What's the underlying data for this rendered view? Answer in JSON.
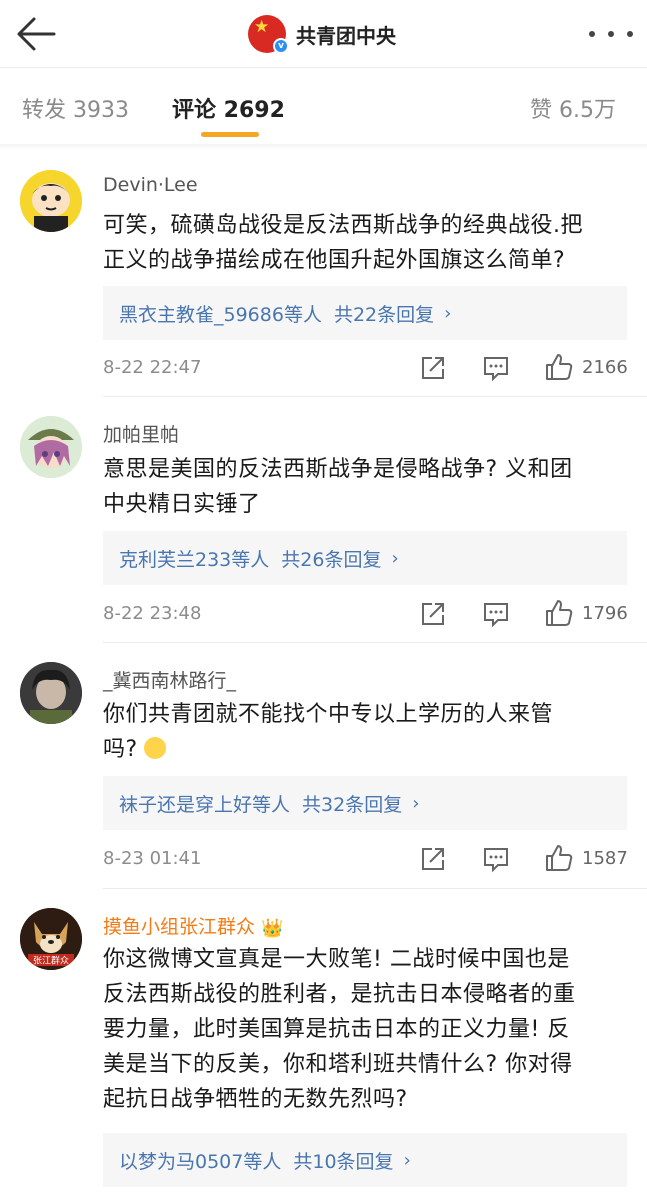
{
  "header": {
    "account_name": "共青团中央",
    "back_icon": "back-arrow-icon",
    "more_icon": "more-dots-icon"
  },
  "tabs": {
    "repost_label": "转发 3933",
    "comment_label": "评论 2692",
    "like_label": "赞 6.5万",
    "accent": "#f6a623"
  },
  "comments": [
    {
      "user": "Devin·Lee",
      "text_line1": "可笑，硫磺岛战役是反法西斯战争的经典战役.把",
      "text_line2": "正义的战争描绘成在他国升起外国旗这么简单?",
      "reply_user": "黑衣主教雀_59686",
      "reply_etc": "等人",
      "reply_count": "共22条回复",
      "time": "8-22 22:47",
      "likes": "2166"
    },
    {
      "user": "加帕里帕",
      "text_line1": "意思是美国的反法西斯战争是侵略战争? 义和团",
      "text_line2": "中央精日实锤了",
      "reply_user": "克利芙兰233",
      "reply_etc": "等人",
      "reply_count": "共26条回复",
      "time": "8-22 23:48",
      "likes": "1796"
    },
    {
      "user": "_冀西南林路行_",
      "text_line1": "你们共青团就不能找个中专以上学历的人来管",
      "text_line2": "吗?",
      "reply_user": "袜子还是穿上好",
      "reply_etc": "等人",
      "reply_count": "共32条回复",
      "time": "8-23 01:41",
      "likes": "1587"
    },
    {
      "user": "摸鱼小组张江群众",
      "text_line1": "你这微博文宣真是一大败笔! 二战时候中国也是",
      "text_line2": "反法西斯战役的胜利者，是抗击日本侵略者的重",
      "text_line3": "要力量，此时美国算是抗击日本的正义力量! 反",
      "text_line4": "美是当下的反美，你和塔利班共情什么? 你对得",
      "text_line5": "起抗日战争牺牲的无数先烈吗?",
      "reply_user": "以梦为马0507",
      "reply_etc": "等人",
      "reply_count": "共10条回复",
      "avatar_text": "张江群众"
    }
  ],
  "colors": {
    "name_vip": "#f37c14",
    "reply_link": "#4a76b0",
    "verified_badge": "#2c8ff3",
    "flag_red": "#d82a23"
  }
}
